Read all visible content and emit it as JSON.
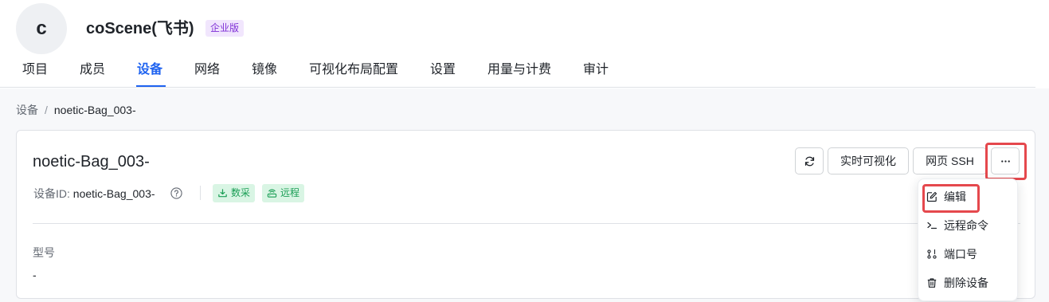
{
  "header": {
    "avatar_letter": "c",
    "org_name": "coScene(飞书)",
    "edition_badge": "企业版"
  },
  "tabs": [
    {
      "label": "项目",
      "active": false
    },
    {
      "label": "成员",
      "active": false
    },
    {
      "label": "设备",
      "active": true
    },
    {
      "label": "网络",
      "active": false
    },
    {
      "label": "镜像",
      "active": false
    },
    {
      "label": "可视化布局配置",
      "active": false
    },
    {
      "label": "设置",
      "active": false
    },
    {
      "label": "用量与计费",
      "active": false
    },
    {
      "label": "审计",
      "active": false
    }
  ],
  "breadcrumb": {
    "root": "设备",
    "separator": "/",
    "current": "noetic-Bag_003-"
  },
  "device": {
    "title": "noetic-Bag_003-",
    "id_label": "设备ID: ",
    "id_value": "noetic-Bag_003-",
    "tags": [
      {
        "label": "数采",
        "icon": "download-tray-icon"
      },
      {
        "label": "远程",
        "icon": "remote-router-icon"
      }
    ],
    "fields": [
      {
        "label": "型号",
        "value": "-"
      }
    ]
  },
  "actions": {
    "refresh_icon": "refresh-icon",
    "realtime_viz": "实时可视化",
    "web_ssh": "网页 SSH",
    "more_icon": "ellipsis-icon"
  },
  "menu": {
    "items": [
      {
        "label": "编辑",
        "icon": "edit-icon"
      },
      {
        "label": "远程命令",
        "icon": "terminal-icon"
      },
      {
        "label": "端口号",
        "icon": "port-icon"
      },
      {
        "label": "删除设备",
        "icon": "trash-icon"
      }
    ]
  },
  "colors": {
    "accent": "#1f63f0",
    "highlight": "#e5484d",
    "tag_bg": "#d9f5e4",
    "tag_text": "#1a9e55",
    "badge_bg": "#f1e6fd",
    "badge_text": "#7f2fd6"
  }
}
